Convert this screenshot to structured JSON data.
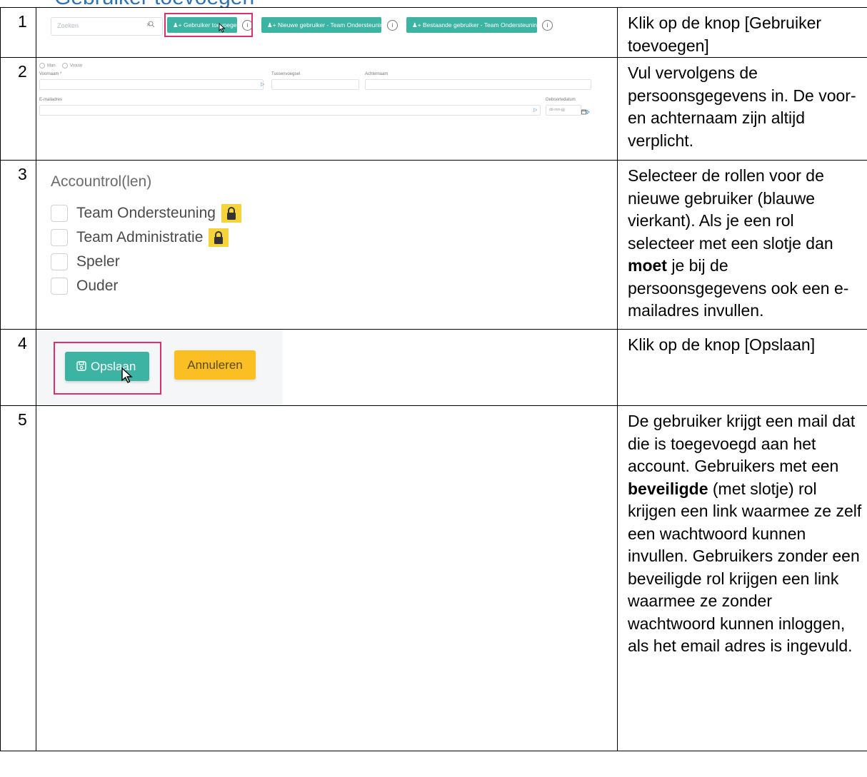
{
  "heading": "Gebruiker toevoegen",
  "steps": [
    {
      "num": "1",
      "description": "Klik op de knop [Gebruiker toevoegen]",
      "toolbar": {
        "search_placeholder": "Zoeken",
        "clear_glyph": "×",
        "search_glyph": "⌕",
        "add_user_label": "Gebruiker toevoegen",
        "new_user_team_label": "Nieuwe gebruiker - Team Ondersteuning",
        "existing_user_team_label": "Bestaande gebruiker - Team Ondersteuning",
        "info_glyph": "i"
      }
    },
    {
      "num": "2",
      "description": "Vul vervolgens de persoonsgegevens in. De voor- en achternaam zijn altijd verplicht.",
      "form": {
        "gender_male": "Man",
        "gender_female": "Vrouw",
        "first_name_label": "Voornaam *",
        "infix_label": "Tussenvoegsel",
        "last_name_label": "Achternaam",
        "email_label": "E-mailadres",
        "birthdate_label": "Geboortedatum",
        "birthdate_placeholder": "dd-mm-jjjj"
      }
    },
    {
      "num": "3",
      "description_parts": [
        "Selecteer de rollen voor de nieuwe gebruiker (blauwe vierkant). Als je een rol selecteer met een slotje dan ",
        "moet",
        " je bij de persoonsgegevens ook een e-mailadres invullen."
      ],
      "roles_title": "Accountrol(len)",
      "roles": [
        {
          "label": "Team Ondersteuning",
          "locked": true
        },
        {
          "label": "Team Administratie",
          "locked": true
        },
        {
          "label": "Speler",
          "locked": false
        },
        {
          "label": "Ouder",
          "locked": false
        }
      ]
    },
    {
      "num": "4",
      "description": "Klik op de knop [Opslaan]",
      "save_label": "Opslaan",
      "cancel_label": "Annuleren"
    },
    {
      "num": "5",
      "description_parts": [
        "De gebruiker krijgt een mail dat die is toegevoegd aan het account. Gebruikers met een ",
        "beveiligde",
        " (met slotje) rol krijgen een link waarmee ze zelf een wachtwoord kunnen invullen. Gebruikers zonder een beveiligde rol krijgen een link waarmee ze zonder wachtwoord kunnen inloggen, als het email adres is ingevuld."
      ]
    }
  ],
  "colors": {
    "teal": "#3cb3a3",
    "highlight": "#e02d6e",
    "cancel": "#fbbf24",
    "lock": "#f6d33a",
    "heading": "#2e74b5"
  }
}
